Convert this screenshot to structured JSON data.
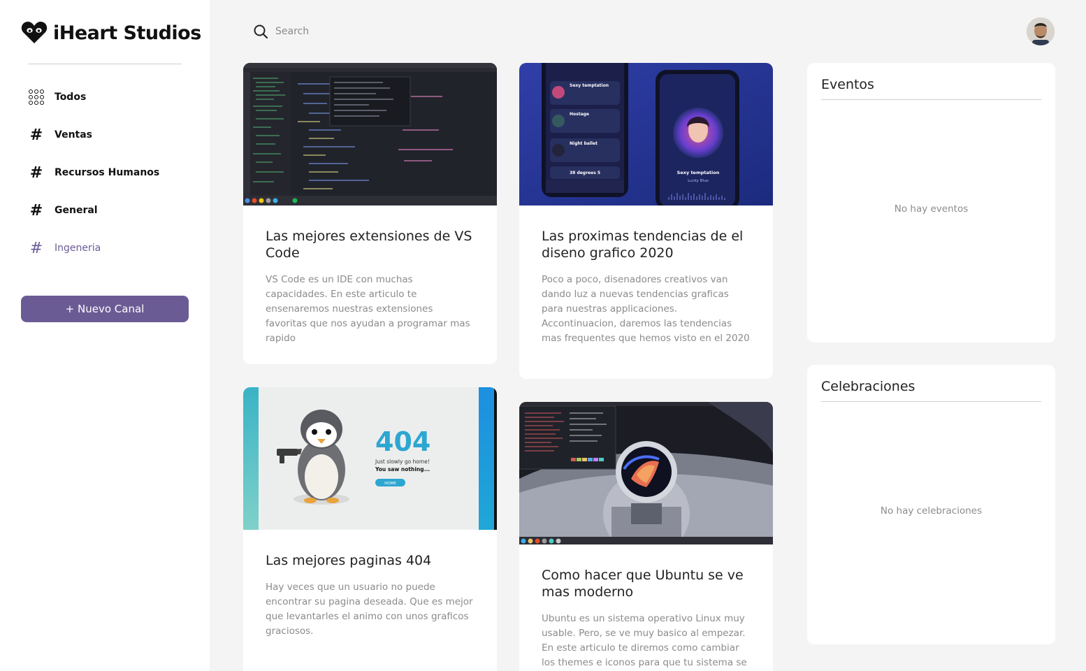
{
  "brand": {
    "name": "iHeart Studios"
  },
  "sidebar": {
    "items": [
      {
        "label": "Todos",
        "icon": "grid-dots-icon"
      },
      {
        "label": "Ventas",
        "icon": "hash-icon"
      },
      {
        "label": "Recursos Humanos",
        "icon": "hash-icon"
      },
      {
        "label": "General",
        "icon": "hash-icon"
      },
      {
        "label": "Ingeneria",
        "icon": "hash-icon",
        "active": true
      }
    ],
    "new_channel_label": "+ Nuevo Canal"
  },
  "search": {
    "placeholder": "Search"
  },
  "colors": {
    "accent": "#6b5b95",
    "background": "#f4f4f4"
  },
  "cards": [
    {
      "title": "Las mejores extensiones de VS Code",
      "text": "VS Code es un IDE con muchas capacidades. En este articulo te ensenaremos nuestras extensiones favoritas que nos ayudan a programar mas rapido"
    },
    {
      "title": "Las proximas tendencias de el diseno grafico 2020",
      "text": "Poco a poco, disenadores creativos van dando luz a nuevas tendencias graficas para nuestras applicaciones. Accontinuacion, daremos las tendencias mas frequentes que hemos visto en el 2020"
    },
    {
      "title": "Las mejores paginas 404",
      "text": "Hay veces que un usuario no puede encontrar su pagina deseada. Que es mejor que levantarles el animo con unos graficos graciosos.",
      "thumb": {
        "code": "404",
        "line1": "Just slowly go home!",
        "line2": "You saw nothing...",
        "button": "HOME"
      }
    },
    {
      "title": "Como hacer que Ubuntu se ve mas moderno",
      "text": "Ubuntu es un sistema operativo Linux muy usable. Pero, se ve muy basico al empezar. En este articulo te diremos como cambiar los themes e iconos para que tu sistema se vea"
    }
  ],
  "design_thumb": {
    "list": [
      "Sexy temptation",
      "Hostage",
      "Night ballet",
      "38 degrees 5"
    ],
    "now_playing": "Sexy temptation",
    "artist": "Lucky Blue"
  },
  "widgets": {
    "events": {
      "title": "Eventos",
      "empty": "No hay eventos"
    },
    "celebrations": {
      "title": "Celebraciones",
      "empty": "No hay celebraciones"
    }
  }
}
